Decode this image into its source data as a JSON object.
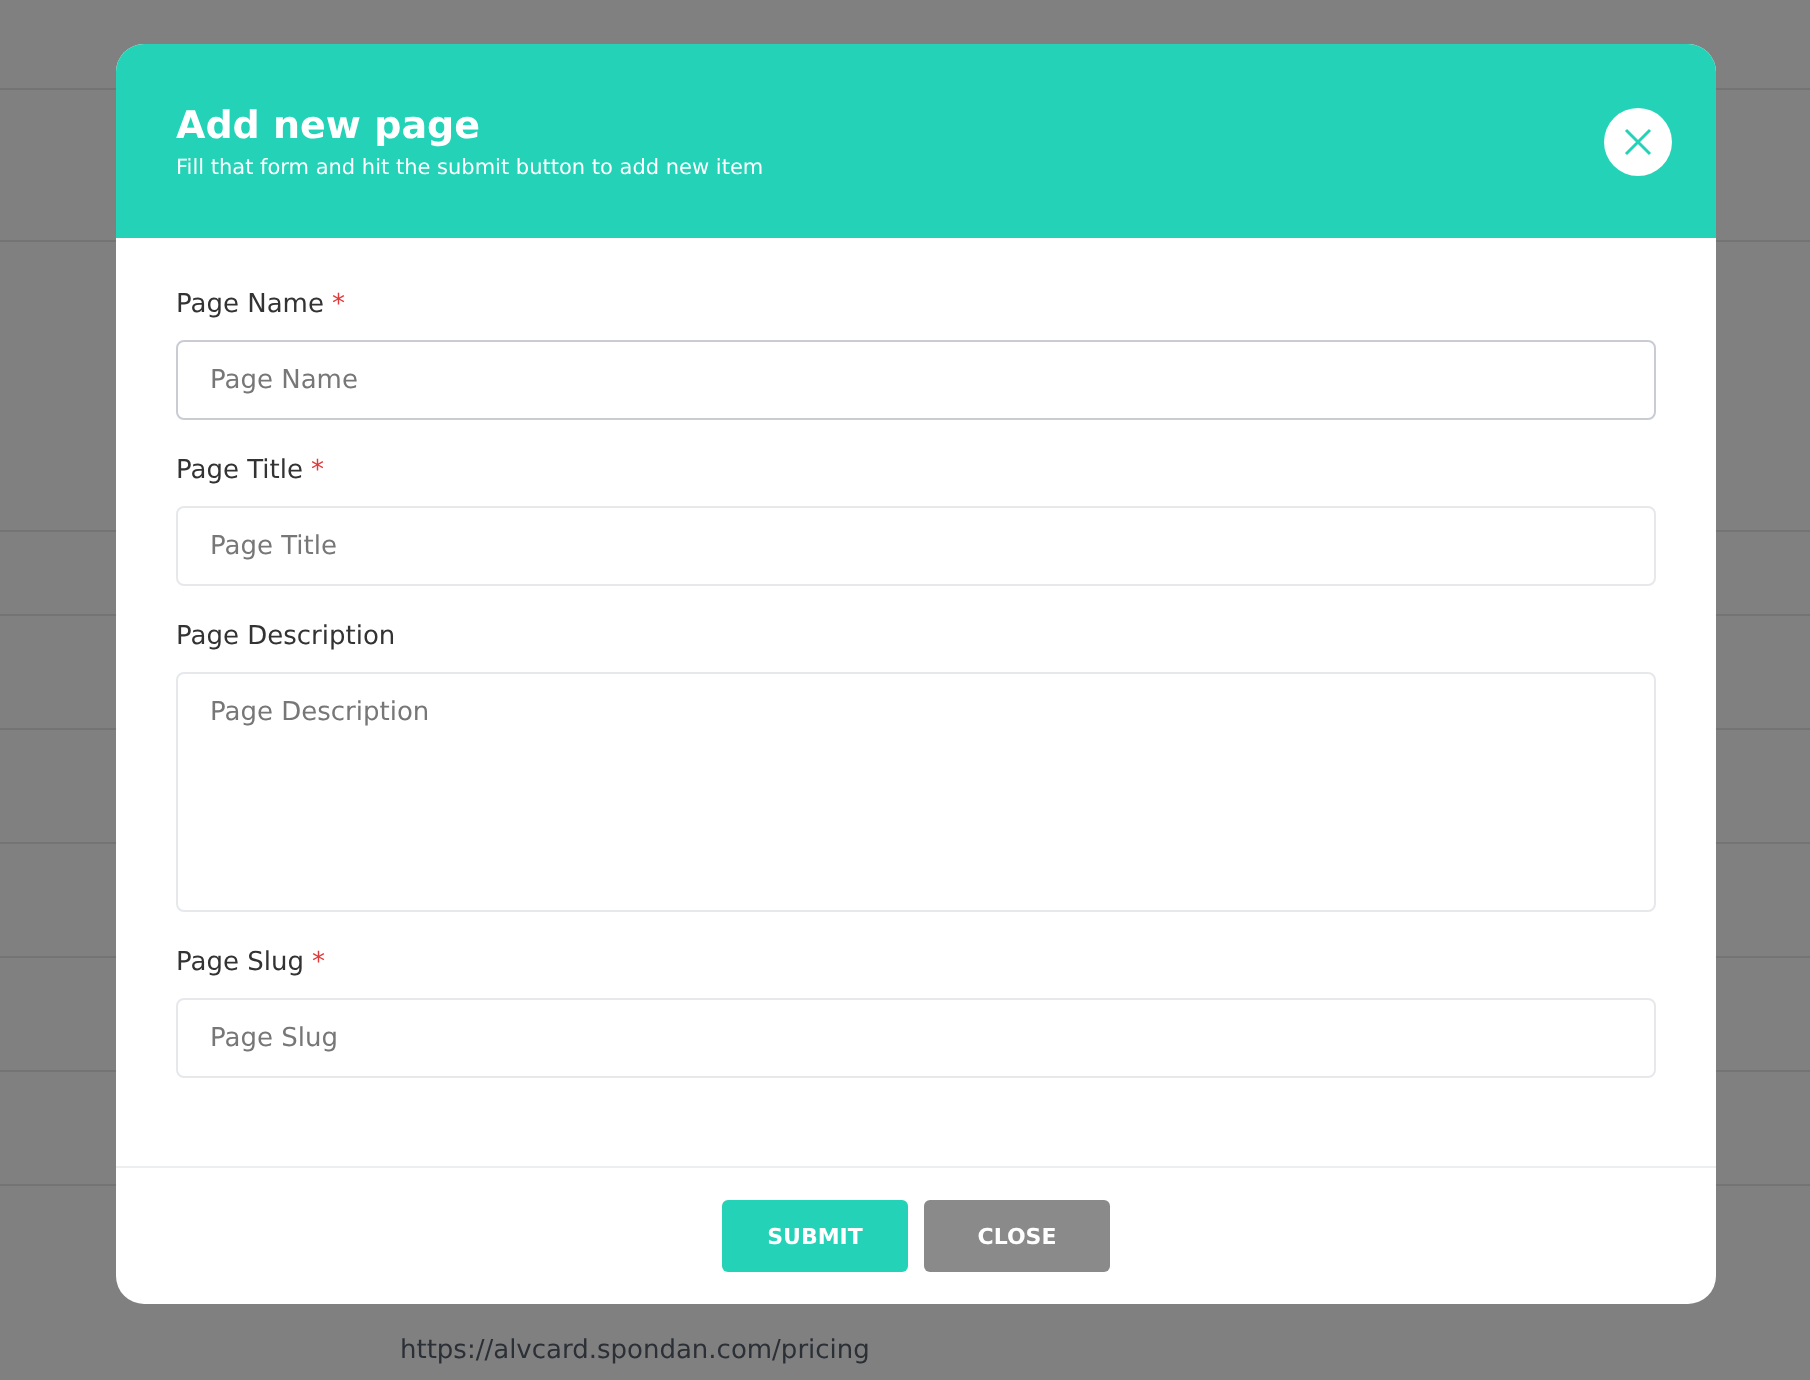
{
  "background": {
    "link": "https://alvcard.spondan.com/pricing"
  },
  "modal": {
    "title": "Add new page",
    "subtitle": "Fill that form and hit the submit button to add new item",
    "fields": [
      {
        "kind": "input",
        "label": "Page Name",
        "required": true,
        "placeholder": "Page Name",
        "focused": true
      },
      {
        "kind": "input",
        "label": "Page Title",
        "required": true,
        "placeholder": "Page Title",
        "focused": false
      },
      {
        "kind": "textarea",
        "label": "Page Description",
        "required": false,
        "placeholder": "Page Description",
        "focused": false
      },
      {
        "kind": "input",
        "label": "Page Slug",
        "required": true,
        "placeholder": "Page Slug",
        "focused": false
      }
    ],
    "required_mark": "*",
    "buttons": [
      {
        "label": "SUBMIT",
        "kind": "primary"
      },
      {
        "label": "CLOSE",
        "kind": "secondary"
      }
    ]
  }
}
